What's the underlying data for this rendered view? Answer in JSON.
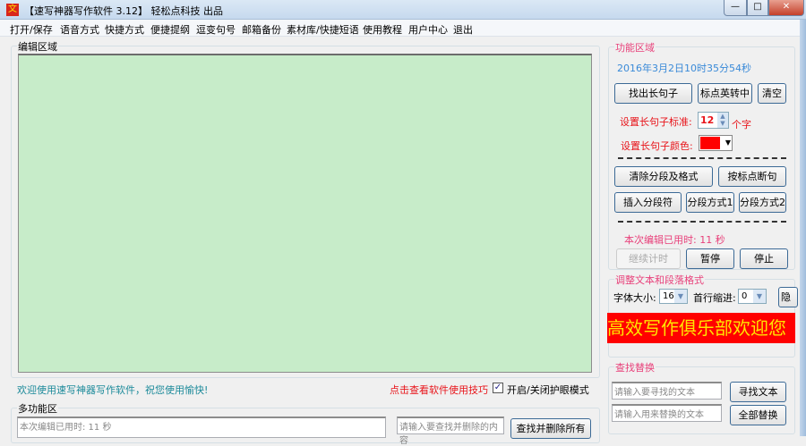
{
  "window": {
    "app_icon": "文",
    "title": "【速写神器写作软件 3.12】 轻松点科技 出品",
    "minimize": "—",
    "maximize": "□",
    "close": "✕"
  },
  "menu": [
    "打开/保存",
    "语音方式",
    "快捷方式",
    "便捷提纲",
    "逗变句号",
    "邮箱备份",
    "素材库/快捷短语",
    "使用教程",
    "用户中心",
    "退出"
  ],
  "editor": {
    "group_label": "编辑区域",
    "content": ""
  },
  "status": {
    "welcome": "欢迎使用速写神器写作软件，祝您使用愉快!",
    "tips_link": "点击查看软件使用技巧",
    "eye_mode_label": "开启/关闭护眼模式",
    "eye_mode_checked": true
  },
  "multi": {
    "group_label": "多功能区",
    "log_text": "本次编辑已用时: 11 秒",
    "delete_placeholder": "请输入要查找并删除的内容",
    "delete_button": "查找并删除所有"
  },
  "func": {
    "group_label": "功能区域",
    "datetime": "2016年3月2日10时35分54秒",
    "find_long": "找出长句子",
    "punct_convert": "标点英转中",
    "clear": "清空",
    "long_std_label": "设置长句子标准:",
    "long_std_value": "12",
    "long_std_unit": "个字",
    "color_label": "设置长句子颜色:",
    "color_value": "#ff0000",
    "clear_format": "清除分段及格式",
    "break_by_punct": "按标点断句",
    "insert_para": "插入分段符",
    "para_mode1": "分段方式1",
    "para_mode2": "分段方式2",
    "elapsed": "本次编辑已用时: 11 秒",
    "resume": "继续计时",
    "pause": "暂停",
    "stop": "停止"
  },
  "format": {
    "group_label": "调整文本和段落格式",
    "font_size_label": "字体大小:",
    "font_size": "16",
    "indent_label": "首行缩进:",
    "indent": "0",
    "hide": "隐藏",
    "banner": "高效写作俱乐部欢迎您"
  },
  "replace": {
    "group_label": "查找替换",
    "find_placeholder": "请输入要寻找的文本",
    "replace_placeholder": "请输入用来替换的文本",
    "find_button": "寻找文本",
    "replace_all_button": "全部替换"
  }
}
